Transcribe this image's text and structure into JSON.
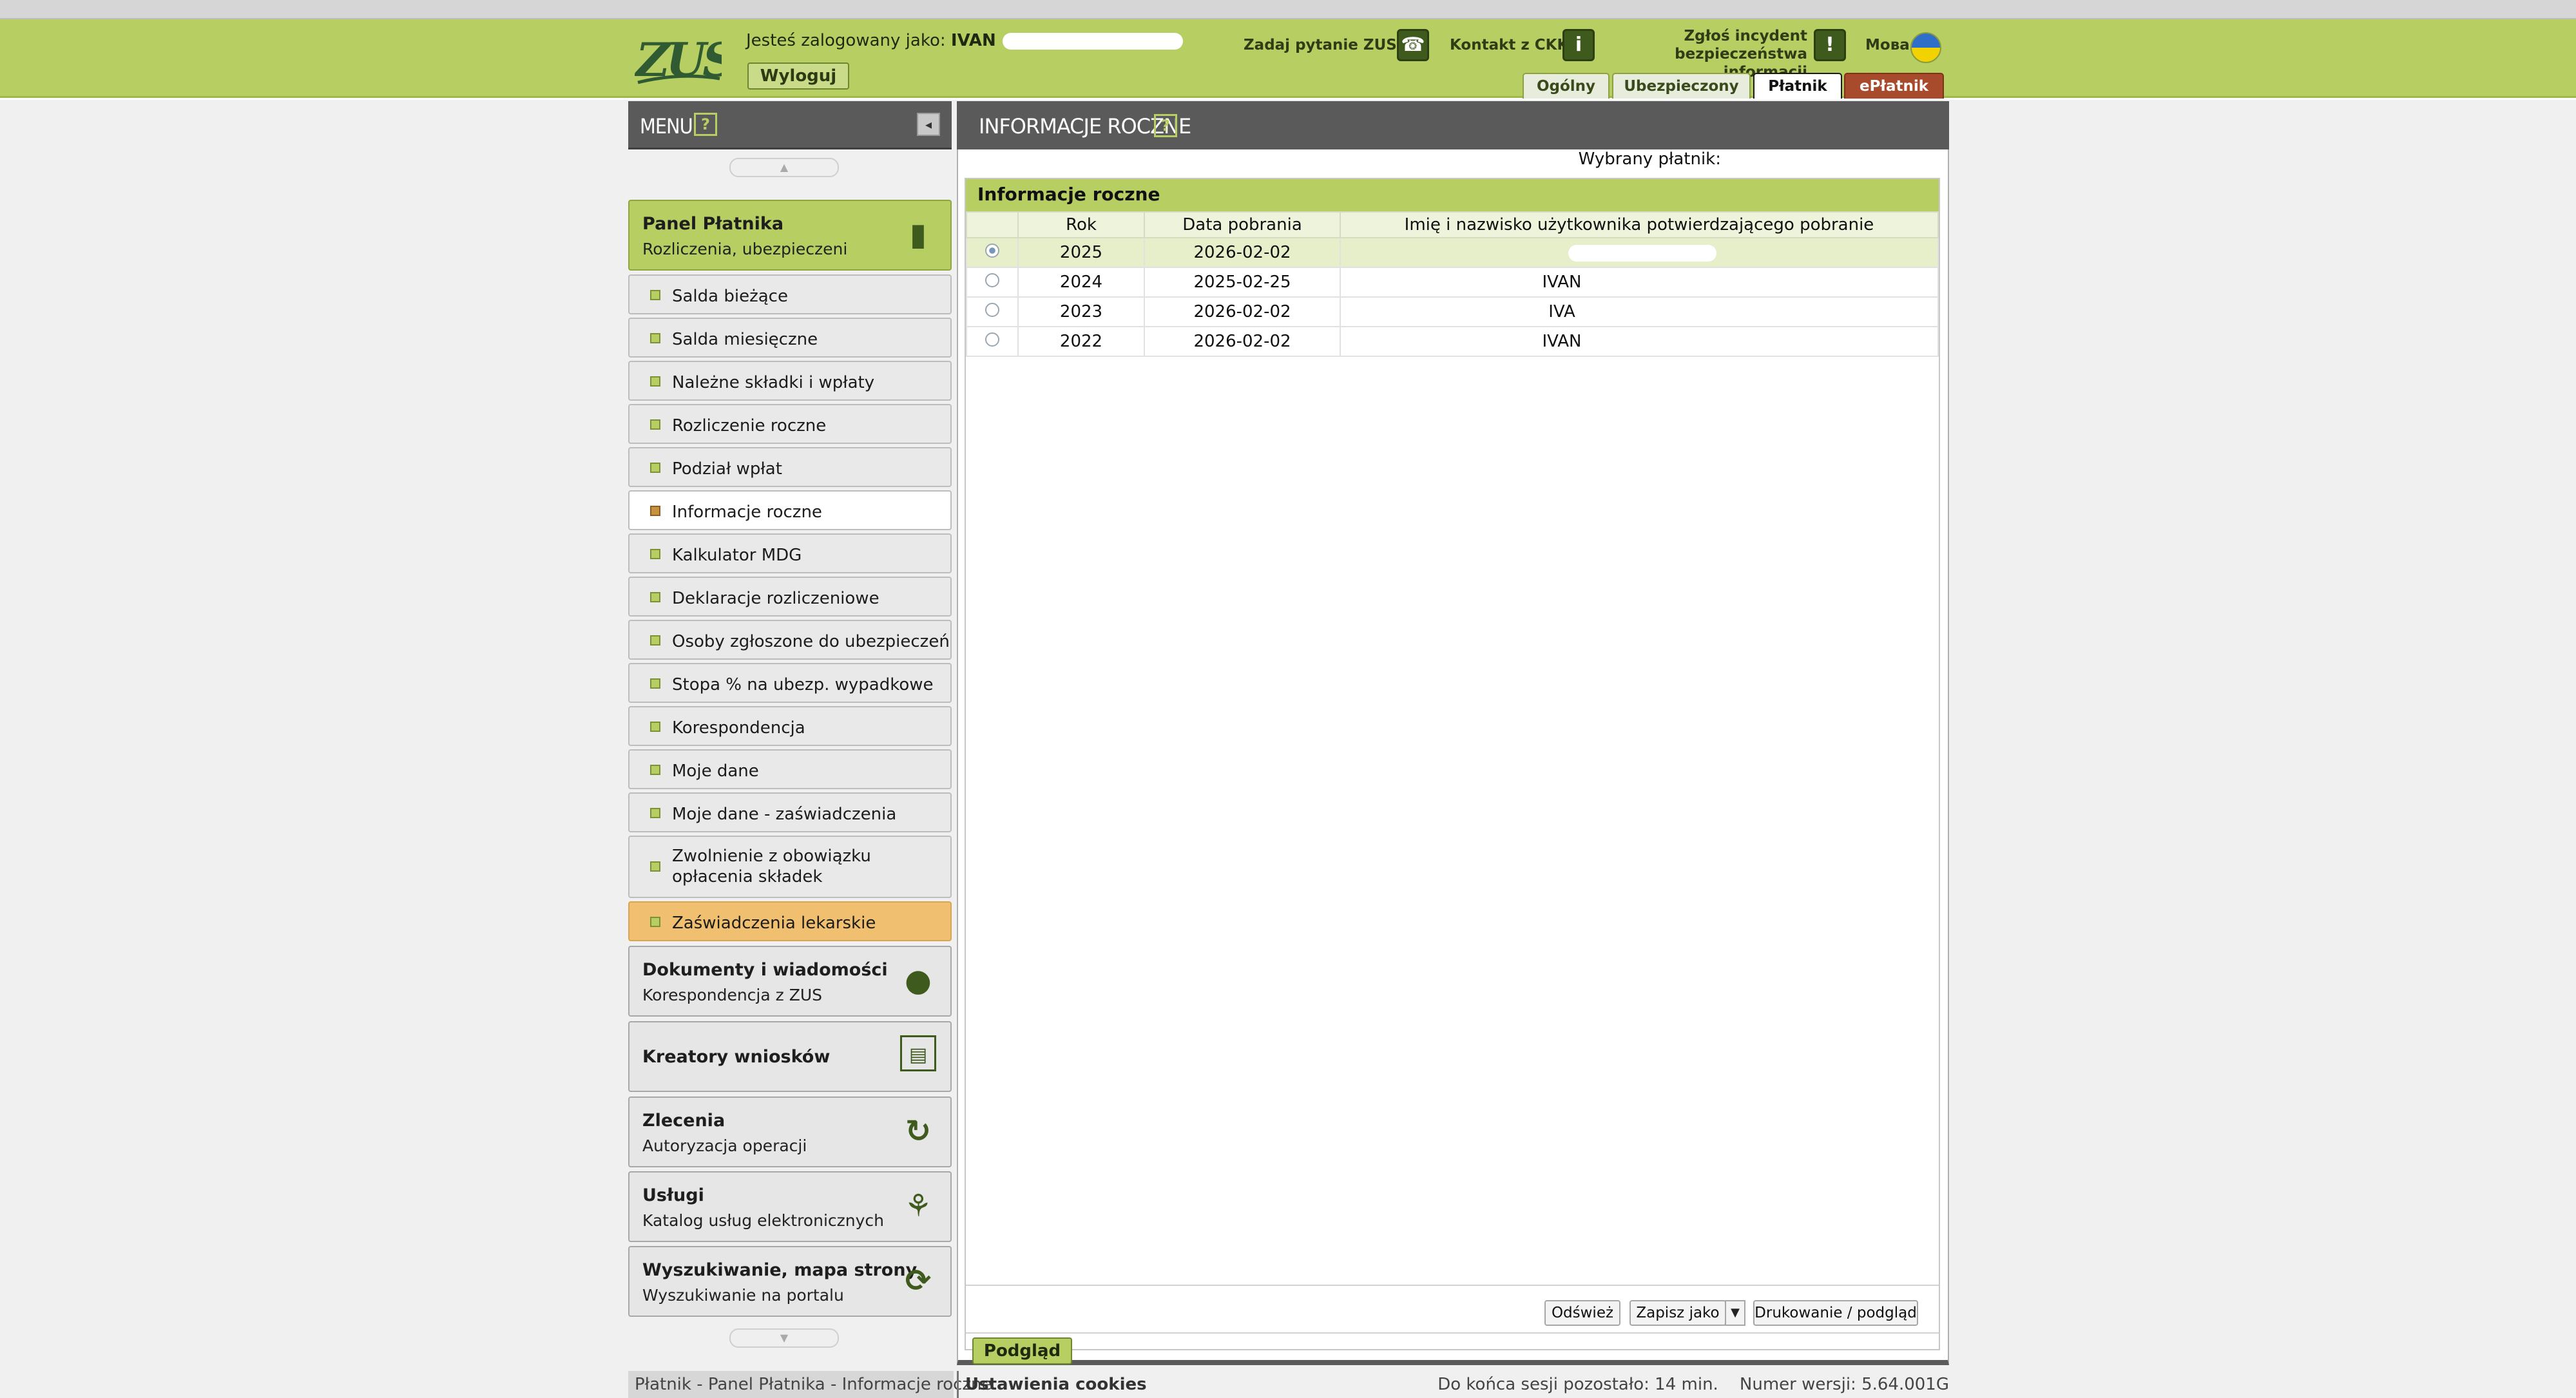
{
  "header": {
    "logo_text": "ZUS",
    "logged_in_label": "Jesteś zalogowany jako:",
    "logged_in_user": "IVAN",
    "logout_label": "Wyloguj",
    "ask_zus_label": "Zadaj pytanie ZUS",
    "contact_ckk_label": "Kontakt z CKK",
    "incident_label_line1": "Zgłoś incydent",
    "incident_label_line2": "bezpieczeństwa informacji",
    "language_label": "Мова",
    "tabs": [
      {
        "label": "Ogólny"
      },
      {
        "label": "Ubezpieczony"
      },
      {
        "label": "Płatnik"
      },
      {
        "label": "ePłatnik"
      }
    ]
  },
  "sidebar": {
    "title": "MENU",
    "help": "?",
    "panel": {
      "title": "Panel Płatnika",
      "subtitle": "Rozliczenia, ubezpieczeni"
    },
    "items": [
      {
        "label": "Salda bieżące"
      },
      {
        "label": "Salda miesięczne"
      },
      {
        "label": "Należne składki i wpłaty"
      },
      {
        "label": "Rozliczenie roczne"
      },
      {
        "label": "Podział wpłat"
      },
      {
        "label": "Informacje roczne"
      },
      {
        "label": "Kalkulator MDG"
      },
      {
        "label": "Deklaracje rozliczeniowe"
      },
      {
        "label": "Osoby zgłoszone do ubezpieczeń"
      },
      {
        "label": "Stopa % na ubezp. wypadkowe"
      },
      {
        "label": "Korespondencja"
      },
      {
        "label": "Moje dane"
      },
      {
        "label": "Moje dane - zaświadczenia"
      },
      {
        "label": "Zwolnienie z obowiązku opłacenia składek"
      },
      {
        "label": "Zaświadczenia lekarskie"
      }
    ],
    "sections": [
      {
        "title": "Dokumenty i wiadomości",
        "subtitle": "Korespondencja z ZUS"
      },
      {
        "title": "Kreatory wniosków",
        "subtitle": ""
      },
      {
        "title": "Zlecenia",
        "subtitle": "Autoryzacja operacji"
      },
      {
        "title": "Usługi",
        "subtitle": "Katalog usług elektronicznych"
      },
      {
        "title": "Wyszukiwanie, mapa strony",
        "subtitle": "Wyszukiwanie na portalu"
      }
    ]
  },
  "main": {
    "title": "INFORMACJE ROCZNE",
    "help": "?",
    "payer_label": "Wybrany płatnik:",
    "section_title": "Informacje roczne",
    "columns": [
      "Rok",
      "Data pobrania",
      "Imię i nazwisko użytkownika potwierdzającego pobranie"
    ],
    "rows": [
      {
        "year": "2025",
        "date": "2026-02-02",
        "user": ""
      },
      {
        "year": "2024",
        "date": "2025-02-25",
        "user": "IVAN"
      },
      {
        "year": "2023",
        "date": "2026-02-02",
        "user": "IVA"
      },
      {
        "year": "2022",
        "date": "2026-02-02",
        "user": "IVAN"
      }
    ],
    "buttons": {
      "refresh": "Odśwież",
      "save_as": "Zapisz jako",
      "print": "Drukowanie / podgląd",
      "preview": "Podgląd"
    }
  },
  "status_bar": {
    "breadcrumb": "Płatnik - Panel Płatnika - Informacje roczne",
    "cookies": "Ustawienia cookies",
    "session": "Do końca sesji pozostało: 14 min.",
    "version": "Numer wersji: 5.64.001G"
  }
}
